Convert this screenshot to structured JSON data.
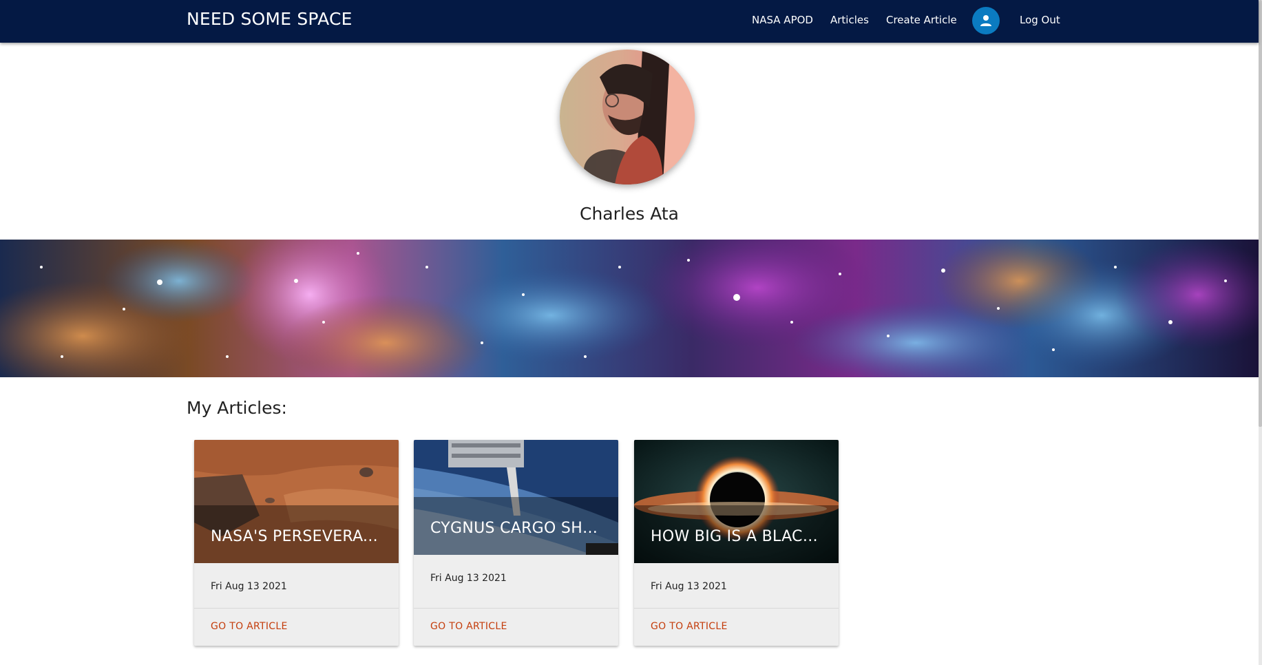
{
  "app": {
    "brand": "NEED SOME SPACE",
    "accent_color": "#041944",
    "link_color": "#c43d0c"
  },
  "nav": {
    "items": [
      {
        "label": "NASA APOD"
      },
      {
        "label": "Articles"
      },
      {
        "label": "Create Article"
      }
    ],
    "account_icon": "person-icon",
    "logout_label": "Log Out"
  },
  "profile": {
    "name": "Charles Ata"
  },
  "articles": {
    "heading": "My Articles:",
    "cards": [
      {
        "title": "NASA'S PERSEVERA...",
        "date": "Fri Aug 13 2021",
        "action": "GO TO ARTICLE"
      },
      {
        "title": "CYGNUS CARGO SHI...",
        "date": "Fri Aug 13 2021",
        "action": "GO TO ARTICLE"
      },
      {
        "title": "HOW BIG IS A BLACK...",
        "date": "Fri Aug 13 2021",
        "action": "GO TO ARTICLE"
      }
    ]
  }
}
